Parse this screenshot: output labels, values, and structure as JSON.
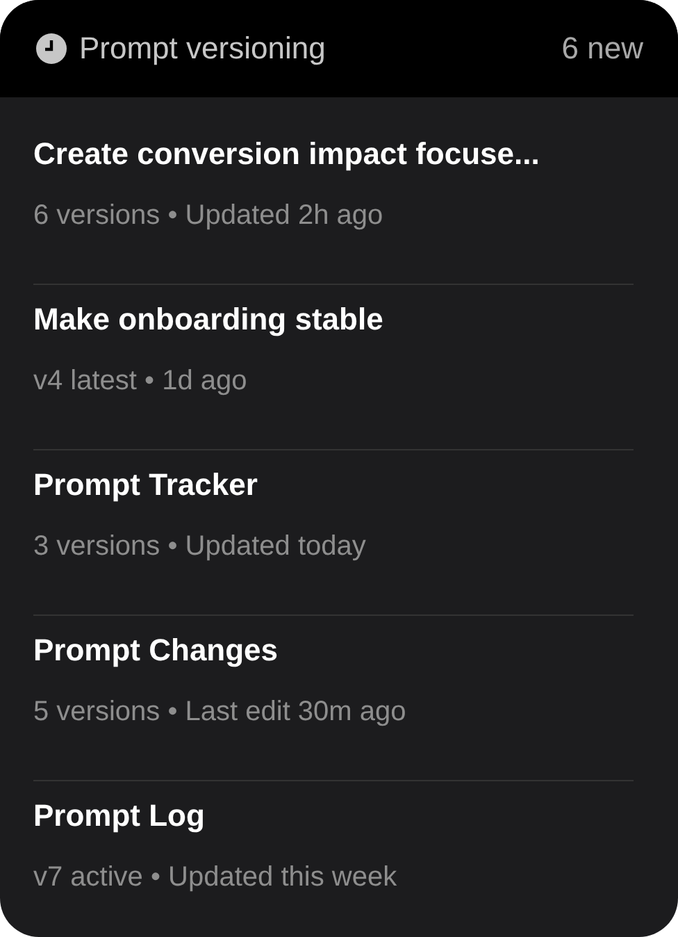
{
  "header": {
    "title": "Prompt versioning",
    "count": "6 new"
  },
  "prompts": [
    {
      "title": "Create conversion impact focuse...",
      "meta": "6 versions • Updated 2h ago"
    },
    {
      "title": "Make onboarding stable",
      "meta": "v4 latest • 1d ago"
    },
    {
      "title": "Prompt Tracker",
      "meta": "3 versions • Updated today"
    },
    {
      "title": "Prompt Changes",
      "meta": "5 versions • Last edit 30m ago"
    },
    {
      "title": "Prompt Log",
      "meta": "v7 active • Updated this week"
    }
  ]
}
